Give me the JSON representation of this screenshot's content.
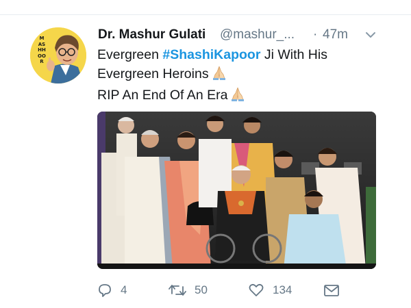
{
  "tweet": {
    "author": {
      "display_name": "Dr. Mashur Gulati",
      "handle": "@mashur_...",
      "avatar_text": "MASHHOOR"
    },
    "separator": "·",
    "timestamp": "47m",
    "text": {
      "line1_prefix": "Evergreen ",
      "hashtag": "#ShashiKapoor",
      "line1_suffix": " Ji With His",
      "line2": "Evergreen Heroins",
      "line3": "RIP An End Of An Era"
    },
    "emoji": "folded-hands",
    "actions": {
      "reply_count": "4",
      "retweet_count": "50",
      "like_count": "134"
    }
  },
  "colors": {
    "text": "#14171a",
    "secondary": "#657786",
    "hashtag": "#1b95e0",
    "divider": "#e6ecf0",
    "avatar_bg": "#f5d64a"
  }
}
